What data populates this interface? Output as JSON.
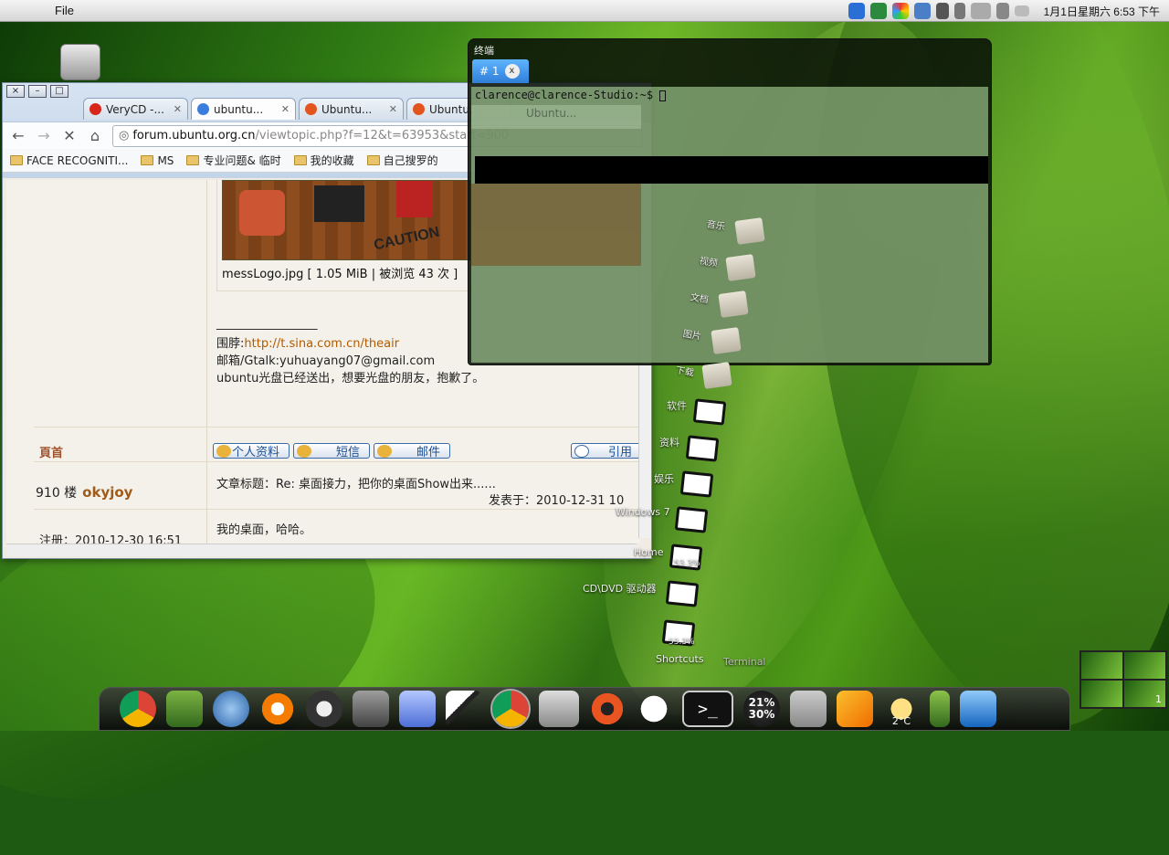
{
  "menubar": {
    "file": "File",
    "clock": "1月1日星期六  6:53 下午"
  },
  "browser": {
    "window_buttons": [
      "×",
      "–",
      "□"
    ],
    "tabs": [
      {
        "label": "VeryCD -...",
        "color": "#d8261a"
      },
      {
        "label": "ubuntu...",
        "color": "#3b7ddd"
      },
      {
        "label": "Ubuntu...",
        "color": "#e2551e"
      },
      {
        "label": "Ubuntu...",
        "color": "#e2551e"
      }
    ],
    "url_host": "forum.ubuntu.org.cn",
    "url_path": "/viewtopic.php?f=12&t=63953&start=900",
    "bookmarks": [
      "FACE RECOGNITI...",
      "MS",
      "专业问题& 临时",
      "我的收藏",
      "自己搜罗的"
    ],
    "post": {
      "caution": "CAUTION",
      "caption": "messLogo.jpg [ 1.05 MiB | 被浏览 43 次 ]",
      "sig_line": "_________________",
      "sig_weibo_label": "围脖:",
      "sig_weibo_link": "http://t.sina.com.cn/theair",
      "sig_mail": "邮箱/Gtalk:yuhuayang07@gmail.com",
      "sig_note": "ubuntu光盘已经送出，想要光盘的朋友，抱歉了。",
      "top_link": "頁首",
      "buttons": [
        "个人资料",
        "短信",
        "邮件",
        "引用"
      ],
      "floor": "910 楼",
      "author": "okyjoy",
      "title": "文章标题：Re: 桌面接力，把你的桌面Show出来......",
      "posted": "发表于：2010-12-31 10",
      "registered": "注册：2010-12-30 16:51",
      "message": "我的桌面，哈哈。"
    }
  },
  "terminal": {
    "title": "终端",
    "tab": "# 1",
    "prompt": "clarence@clarence-Studio:~$",
    "ghost_tab": "Ubuntu..."
  },
  "desktop": {
    "folders": [
      "音乐",
      "视频",
      "文档",
      "图片",
      "下载"
    ],
    "devices": [
      "软件",
      "资料",
      "娱乐",
      "Windows 7",
      "Home",
      "CD\\DVD 驱动器"
    ],
    "usage": [
      "53.3%",
      "53.3%"
    ],
    "dock_labels": [
      "Shortcuts",
      "Terminal"
    ],
    "dock_meter": [
      "21%",
      "30%"
    ],
    "temperature": "2°C",
    "pager_current": "1"
  }
}
